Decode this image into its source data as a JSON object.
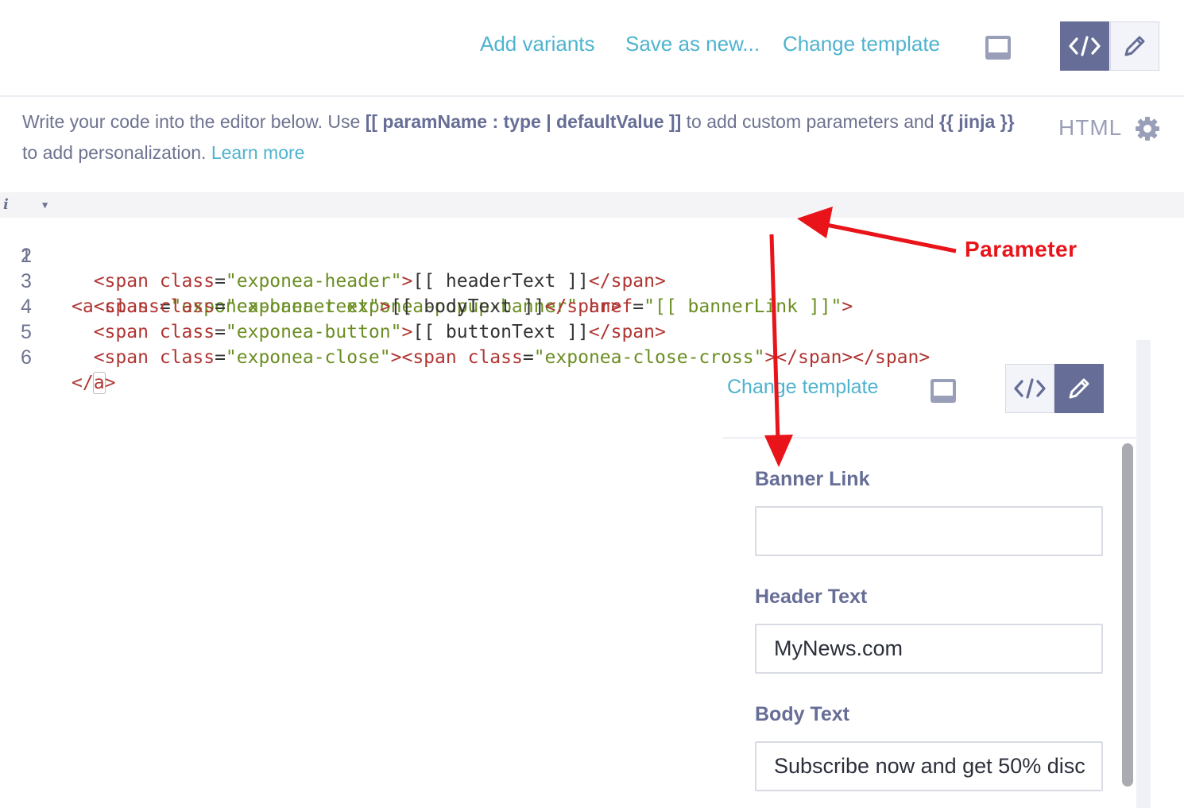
{
  "toolbar": {
    "add_variants": "Add variants",
    "save_as_new": "Save as new...",
    "change_template": "Change template",
    "code_icon_text": "</>"
  },
  "help": {
    "part1": "Write your code into the editor below. Use ",
    "param_syntax_open": "[[ ",
    "param_syntax": "paramName : type | defaultValue",
    "param_syntax_close": " ]]",
    "part2": " to add custom parameters and ",
    "jinja_open": "{{ ",
    "jinja": "jinja",
    "jinja_close": " }}",
    "part3": " to add personalization. ",
    "learn_more": "Learn more"
  },
  "mode": {
    "label": "HTML"
  },
  "editor": {
    "line_numbers": [
      "1",
      "2",
      "3",
      "4",
      "5",
      "6"
    ]
  },
  "panel": {
    "change_template": "Change template",
    "code_icon_text": "</>",
    "fields": [
      {
        "label": "Banner Link",
        "value": ""
      },
      {
        "label": "Header Text",
        "value": "MyNews.com"
      },
      {
        "label": "Body Text",
        "value": "Subscribe now and get 50% disc"
      }
    ]
  },
  "annotation": {
    "label": "Parameter",
    "color": "#e8141a"
  },
  "colors": {
    "accent": "#4fb3cf",
    "segment_active": "#666d96",
    "label": "#666d96"
  }
}
